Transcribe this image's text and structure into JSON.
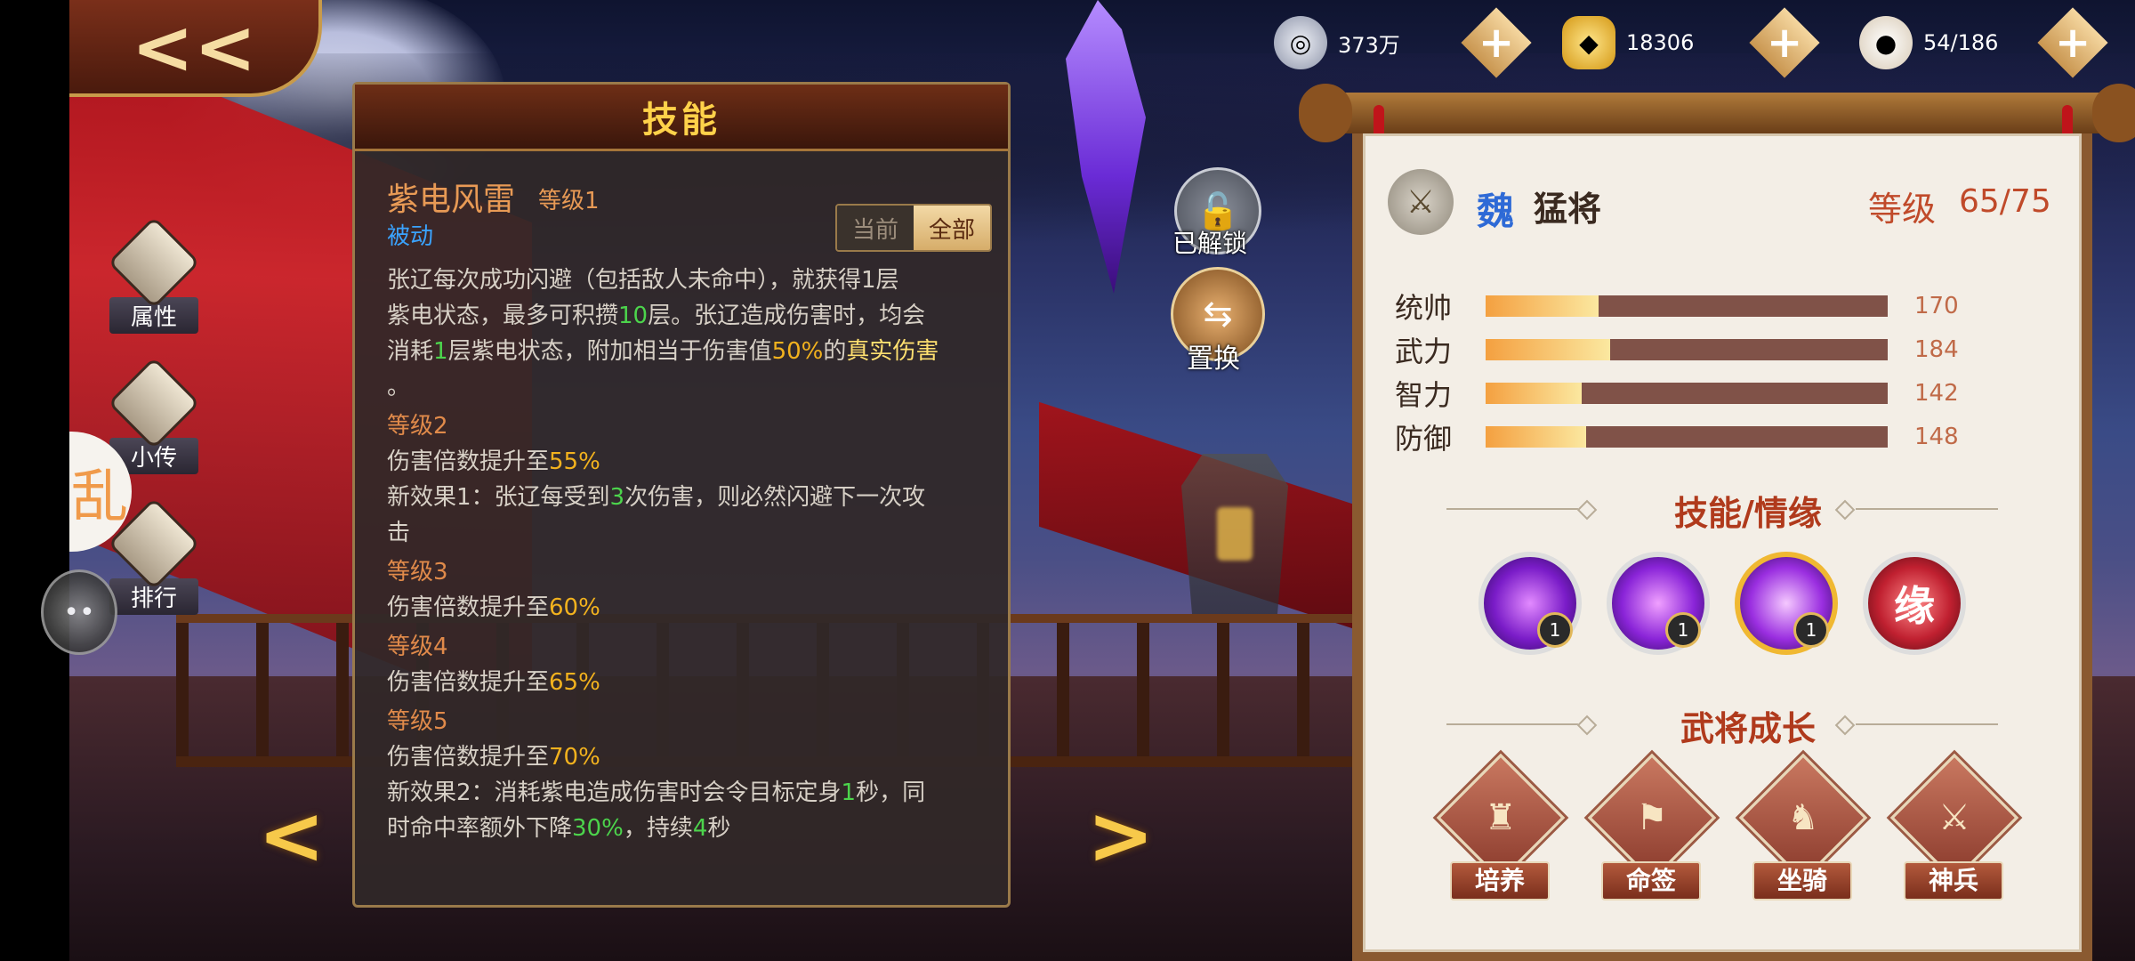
{
  "header": {
    "back_icon": "back-arrow-icon"
  },
  "side_menu": [
    {
      "label": "属性",
      "icon": "scroll-icon"
    },
    {
      "label": "小传",
      "icon": "book-icon"
    },
    {
      "label": "排行",
      "icon": "ranking-icon"
    }
  ],
  "float_ball": {
    "glyph": "乱"
  },
  "currencies": [
    {
      "icon": "silver-coin-icon",
      "value": "373万"
    },
    {
      "icon": "gold-ingot-icon",
      "value": "18306"
    },
    {
      "icon": "bun-icon",
      "value": "54/186"
    }
  ],
  "skill_panel": {
    "title": "技能",
    "skill_name": "紫电风雷",
    "skill_level": "等级1",
    "skill_type": "被动",
    "toggle_current": "当前",
    "toggle_all": "全部",
    "desc": {
      "l1a": "张辽每次成功闪避（包括敌人未命中），就获得1层",
      "l2a": "紫电状态，最多可积攒",
      "l2b": "10",
      "l2c": "层。张辽造成伤害时，均会",
      "l3a": "消耗",
      "l3b": "1",
      "l3c": "层紫电状态，附加相当于伤害值",
      "l3d": "50%",
      "l3e": "的",
      "l3f": "真实伤害",
      "l4": "。"
    },
    "levels": [
      {
        "label": "等级2",
        "line1": "伤害倍数提升至",
        "val1": "55%",
        "extra_a": "新效果1：张辽每受到",
        "extra_b": "3",
        "extra_c": "次伤害，则必然闪避下一次攻",
        "extra_d": "击"
      },
      {
        "label": "等级3",
        "line1": "伤害倍数提升至",
        "val1": "60%"
      },
      {
        "label": "等级4",
        "line1": "伤害倍数提升至",
        "val1": "65%"
      },
      {
        "label": "等级5",
        "line1": "伤害倍数提升至",
        "val1": "70%",
        "extra_a": "新效果2：消耗紫电造成伤害时会令目标定身",
        "extra_b": "1",
        "extra_c": "秒，同",
        "extra_d": "时命中率额外下降",
        "extra_e": "30%",
        "extra_f": "，持续",
        "extra_g": "4",
        "extra_h": "秒"
      }
    ]
  },
  "actions": {
    "unlocked_label": "已解锁",
    "swap_label": "置换"
  },
  "hero": {
    "faction": "魏",
    "title": "猛将",
    "level_label": "等级",
    "level_value": "65/75",
    "stats": [
      {
        "name": "统帅",
        "value": "170",
        "fill_pct": 28
      },
      {
        "name": "武力",
        "value": "184",
        "fill_pct": 31
      },
      {
        "name": "智力",
        "value": "142",
        "fill_pct": 24
      },
      {
        "name": "防御",
        "value": "148",
        "fill_pct": 25
      }
    ],
    "section_skills": "技能/情缘",
    "skill_icons": [
      {
        "icon": "purple-slash-skill-icon",
        "badge": "1"
      },
      {
        "icon": "purple-lightning-skill-icon",
        "badge": "1"
      },
      {
        "icon": "purple-dash-skill-icon",
        "badge": "1"
      },
      {
        "icon": "fate-skill-icon",
        "glyph": "缘"
      }
    ],
    "section_growth": "武将成长",
    "growth": [
      {
        "label": "培养",
        "icon": "general-icon"
      },
      {
        "label": "命签",
        "icon": "lots-icon"
      },
      {
        "label": "坐骑",
        "icon": "horse-icon"
      },
      {
        "label": "神兵",
        "icon": "weapon-icon"
      }
    ]
  },
  "colors": {
    "accent_gold": "#ffd24a",
    "highlight_green": "#4cd44c",
    "highlight_yellow": "#f2b21e",
    "level_red": "#c04a2a"
  }
}
